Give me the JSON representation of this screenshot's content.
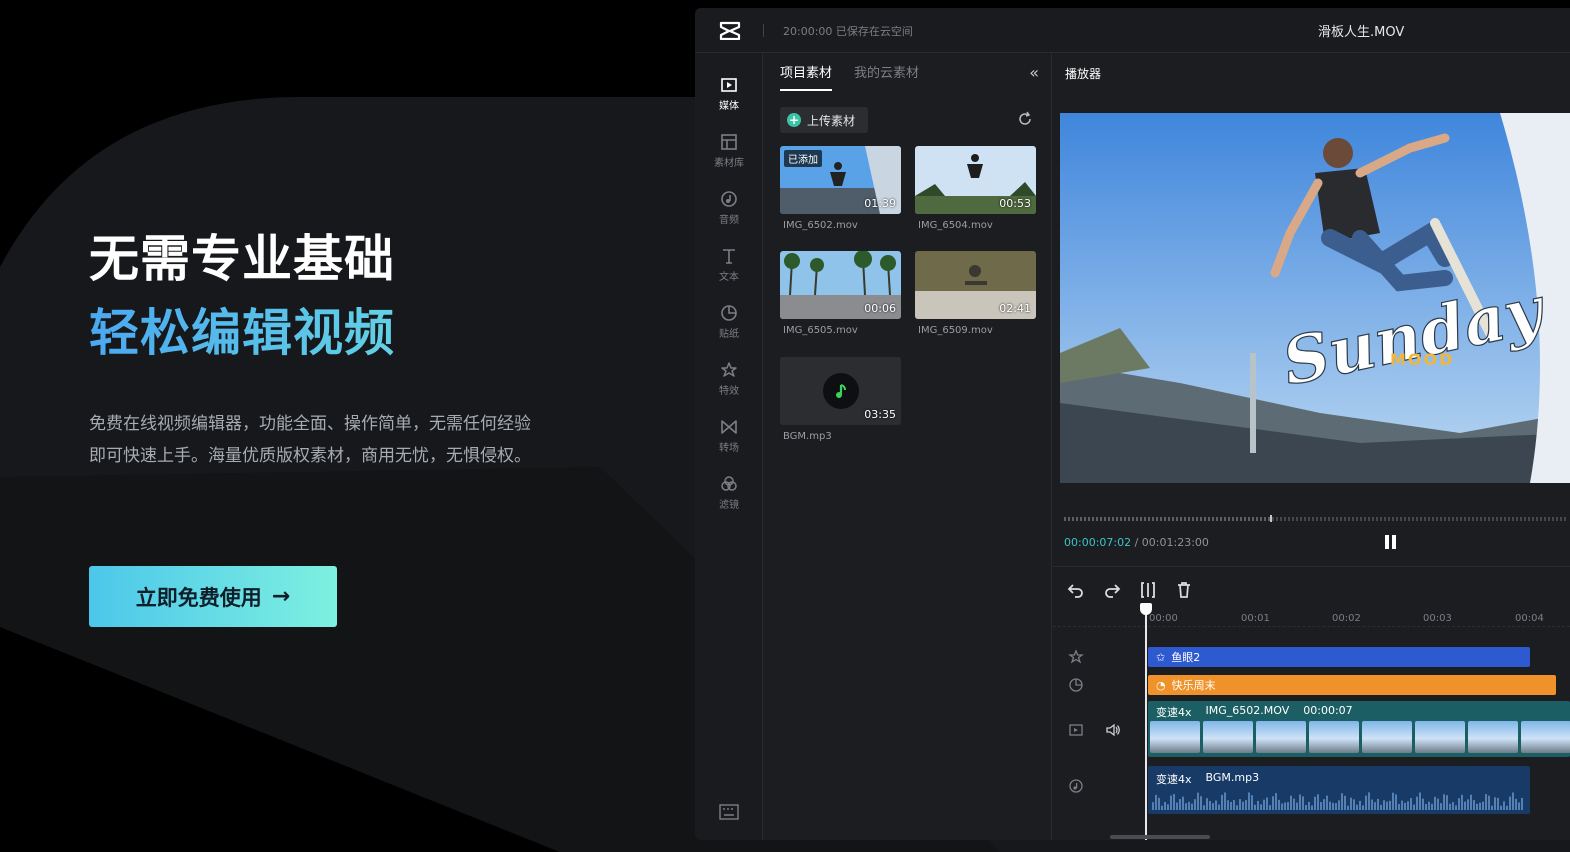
{
  "hero": {
    "title_line1": "无需专业基础",
    "title_line2": "轻松编辑视频",
    "description": "免费在线视频编辑器，功能全面、操作简单，无需任何经验即可快速上手。海量优质版权素材，商用无忧，无惧侵权。",
    "cta_label": "立即免费使用",
    "cta_arrow": "→"
  },
  "app": {
    "save_status": "20:00:00 已保存在云空间",
    "file_name": "滑板人生.MOV",
    "rail": [
      {
        "label": "媒体",
        "icon": "media-icon",
        "active": true
      },
      {
        "label": "素材库",
        "icon": "library-icon"
      },
      {
        "label": "音频",
        "icon": "audio-icon"
      },
      {
        "label": "文本",
        "icon": "text-icon"
      },
      {
        "label": "贴纸",
        "icon": "sticker-icon"
      },
      {
        "label": "特效",
        "icon": "effects-icon"
      },
      {
        "label": "转场",
        "icon": "transition-icon"
      },
      {
        "label": "滤镜",
        "icon": "filter-icon"
      }
    ],
    "media_panel": {
      "tabs": [
        "项目素材",
        "我的云素材"
      ],
      "upload_label": "上传素材",
      "items": [
        {
          "name": "IMG_6502.mov",
          "duration": "01:39",
          "badge": "已添加"
        },
        {
          "name": "IMG_6504.mov",
          "duration": "00:53"
        },
        {
          "name": "IMG_6505.mov",
          "duration": "00:06"
        },
        {
          "name": "IMG_6509.mov",
          "duration": "02:41"
        },
        {
          "name": "BGM.mp3",
          "duration": "03:35"
        }
      ]
    },
    "player": {
      "title": "播放器",
      "current_time": "00:00:07:02",
      "total_time": "/ 00:01:23:00",
      "overlay_text": "Sunday",
      "overlay_sub": "MOOD"
    },
    "timeline": {
      "ruler": [
        "00:00",
        "00:01",
        "00:02",
        "00:03",
        "00:04"
      ],
      "fx_clip": "鱼眼2",
      "sticker_clip": "快乐周末",
      "video_clip": {
        "speed": "变速4x",
        "name": "IMG_6502.MOV",
        "duration": "00:00:07"
      },
      "audio_clip": {
        "speed": "变速4x",
        "name": "BGM.mp3"
      }
    }
  }
}
